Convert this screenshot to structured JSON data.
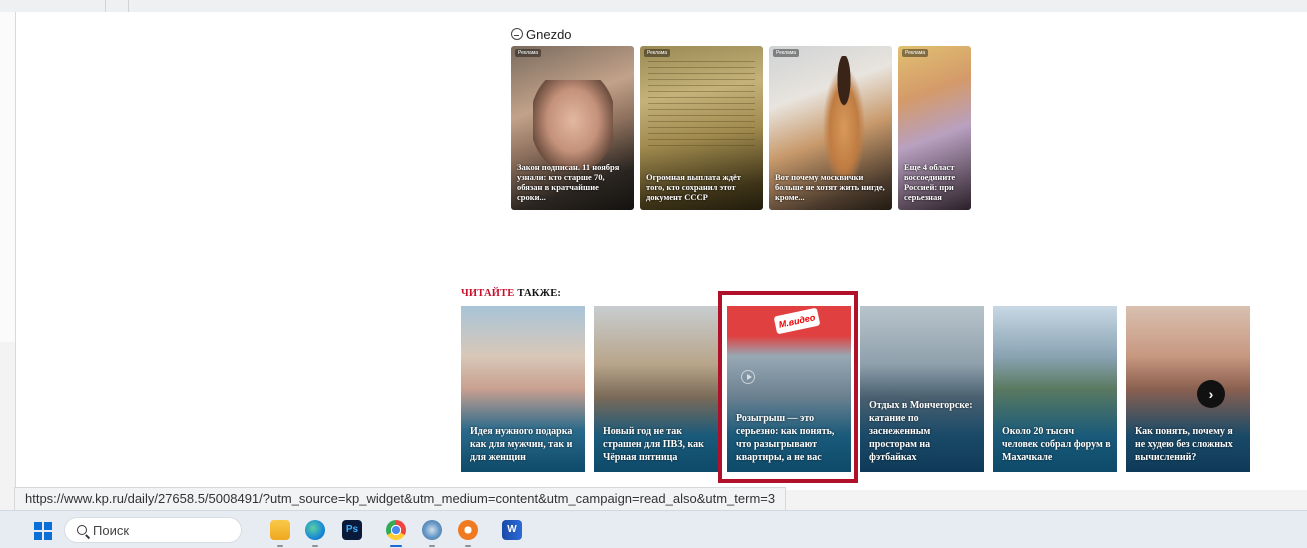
{
  "gnezdo": {
    "brand": "Gnezdo",
    "cards": [
      {
        "tag": "Реклама",
        "text": "Закон подписан. 11 ноября узнали: кто старше 70, обязан в кратчайшие сроки..."
      },
      {
        "tag": "Реклама",
        "text": "Огромная выплата ждёт того, кто сохранил этот документ СССР"
      },
      {
        "tag": "Реклама",
        "text": "Вот почему москвички больше не хотят жить нигде, кроме..."
      },
      {
        "tag": "Реклама",
        "text": "Еще 4 област воссоедините Россией: при серьезная"
      }
    ]
  },
  "read_also": {
    "title_red": "ЧИТАЙТЕ",
    "title_black": " ТАКЖЕ:",
    "cards": [
      {
        "text": "Идея нужного подарка как для мужчин, так и для женщин"
      },
      {
        "text": "Новый год не так страшен для ПВЗ, как Чёрная пятница"
      },
      {
        "text": "Розыгрыш — это серьезно: как понять, что разыгрывают квартиры, а не вас",
        "logo": "М.видео"
      },
      {
        "text": "Отдых в Мончегорске: катание по заснеженным просторам на фэтбайках"
      },
      {
        "text": "Около 20 тысяч человек собрал форум в Махачкале"
      },
      {
        "text": "Как понять, почему я не худею без сложных вычислений?"
      }
    ],
    "next_label": "›"
  },
  "status_bar": {
    "url": "https://www.kp.ru/daily/27658.5/5008491/?utm_source=kp_widget&utm_medium=content&utm_campaign=read_also&utm_term=3"
  },
  "taskbar": {
    "search_placeholder": "Поиск",
    "apps": [
      "file-explorer-icon",
      "edge-icon",
      "photoshop-icon",
      "chrome-icon",
      "settings-icon",
      "orange-app-icon",
      "word-icon"
    ],
    "ps_label": "Ps",
    "word_label": "W"
  }
}
